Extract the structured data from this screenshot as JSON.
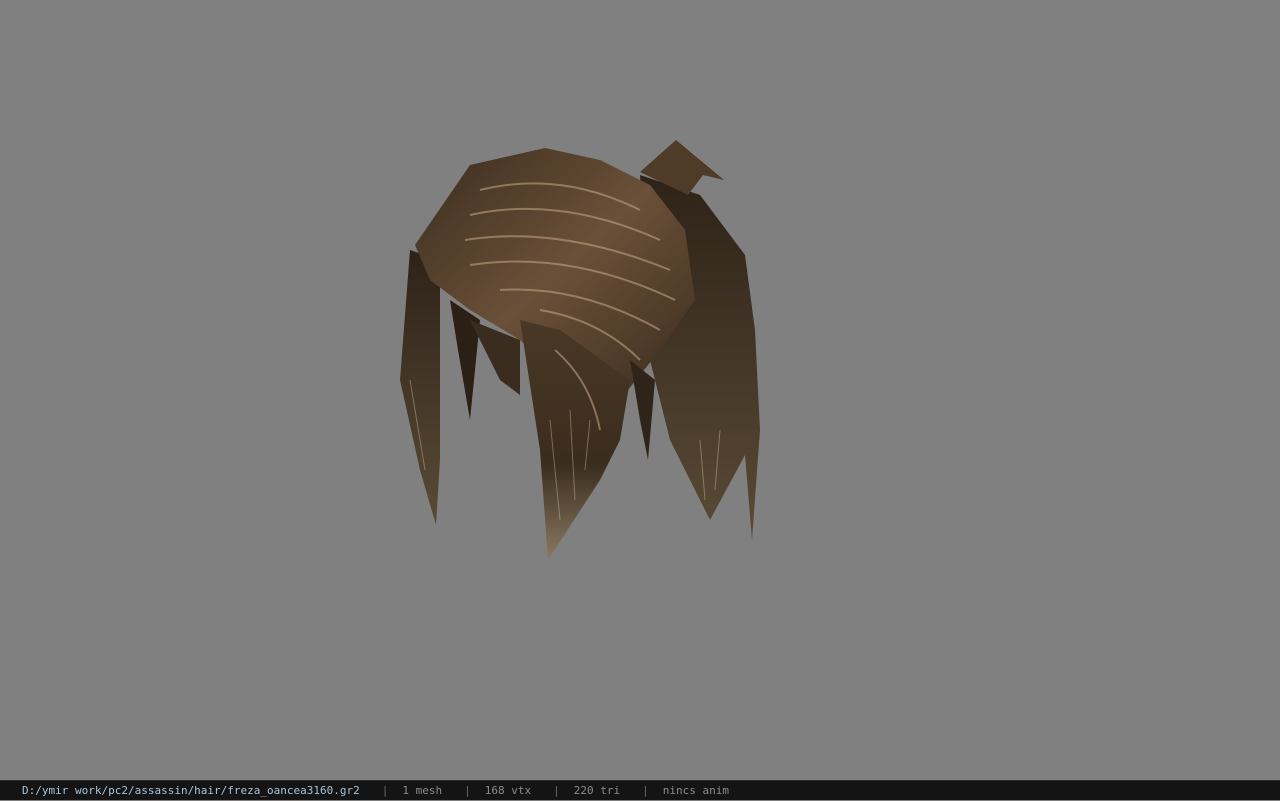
{
  "viewport": {
    "background": "#808080"
  },
  "model": {
    "subject": "hair mesh",
    "colors": {
      "dark": "#2a2016",
      "mid": "#5a4632",
      "light": "#9a7a5a",
      "highlight": "#c8a886"
    }
  },
  "statusbar": {
    "file_path": "D:/ymir work/pc2/assassin/hair/freza_oancea3160.gr2",
    "separator": "|",
    "mesh_count": "1 mesh",
    "vertex_count": "168 vtx",
    "triangle_count": "220 tri",
    "animation": "nincs anim"
  }
}
